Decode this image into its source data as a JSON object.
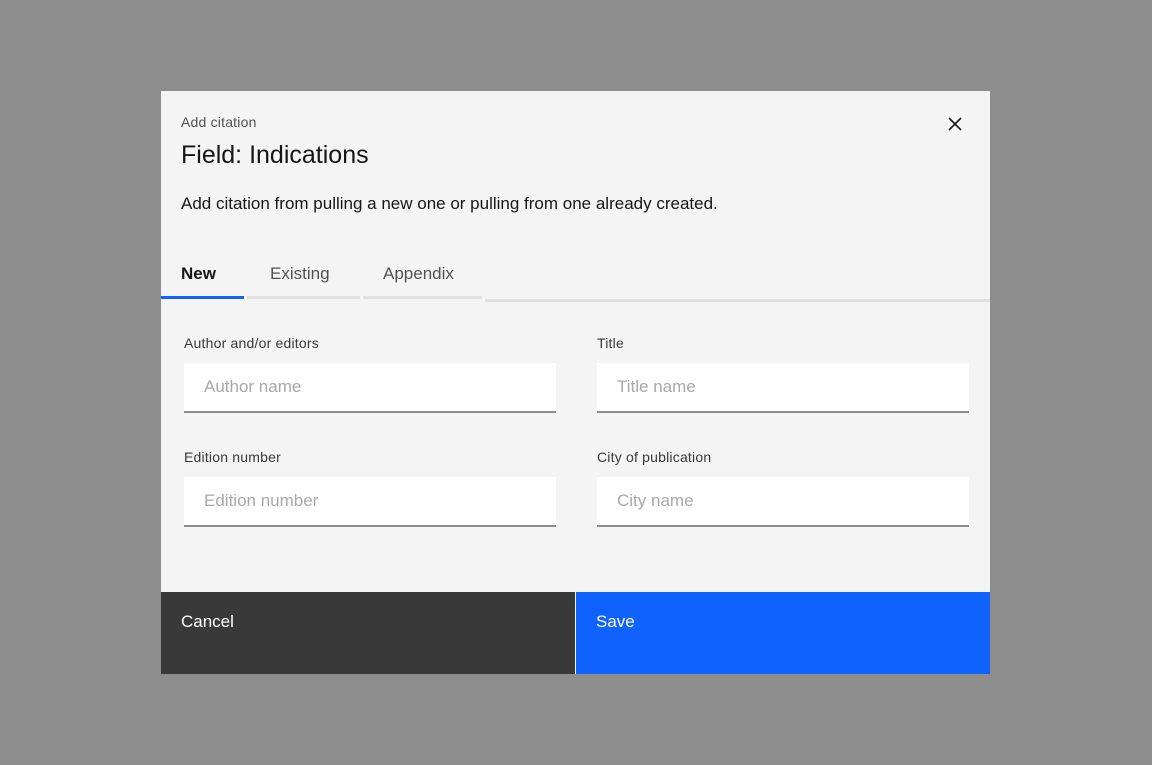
{
  "modal": {
    "label": "Add citation",
    "heading": "Field: Indications",
    "description": "Add citation from pulling a new one or pulling from one already created.",
    "close_icon": "close-icon"
  },
  "tabs": [
    {
      "label": "New",
      "active": true
    },
    {
      "label": "Existing",
      "active": false
    },
    {
      "label": "Appendix",
      "active": false
    }
  ],
  "fields": {
    "author": {
      "label": "Author and/or editors",
      "placeholder": "Author name",
      "value": ""
    },
    "title": {
      "label": "Title",
      "placeholder": "Title name",
      "value": ""
    },
    "edition": {
      "label": "Edition number",
      "placeholder": "Edition number",
      "value": ""
    },
    "city": {
      "label": "City of publication",
      "placeholder": "City name",
      "value": ""
    }
  },
  "footer": {
    "cancel_label": "Cancel",
    "save_label": "Save"
  },
  "colors": {
    "primary": "#0f62fe",
    "secondary": "#393939",
    "overlay": "#8d8d8d",
    "modal_bg": "#f4f4f4"
  }
}
